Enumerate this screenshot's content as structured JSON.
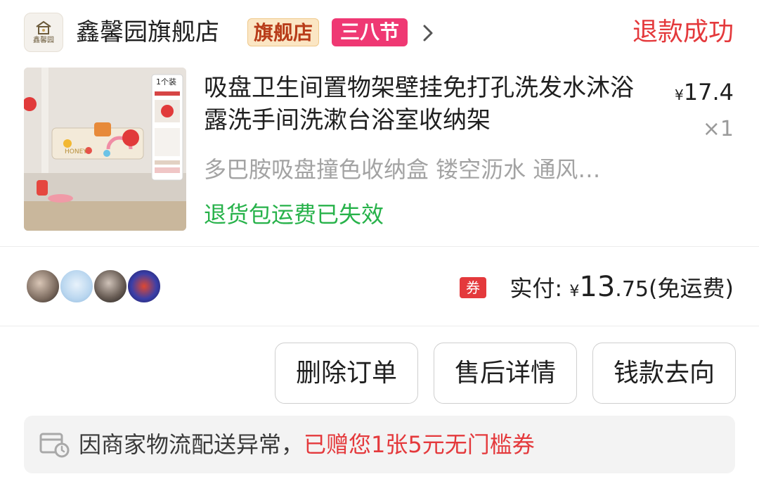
{
  "store": {
    "logo_text": "鑫馨园",
    "name": "鑫馨园旗舰店",
    "badge_flagship": "旗舰店",
    "badge_event": "三八节",
    "chevron_icon": "chevron-right-icon"
  },
  "order": {
    "status": "退款成功",
    "status_color": "#e4393c"
  },
  "product": {
    "title": "吸盘卫生间置物架壁挂免打孔洗发水沐浴露洗手间洗漱台浴室收纳架",
    "price_symbol": "¥",
    "price": "17.4",
    "quantity": "×1",
    "spec": "多巴胺吸盘撞色收纳盒 镂空沥水 通风…",
    "return_note": "退货包运费已失效",
    "image_labels": {
      "count": "1个装",
      "tag": "HONEY"
    }
  },
  "payment": {
    "coupon_icon_text": "券",
    "label": "实付:",
    "symbol": "¥",
    "amount_int": "13",
    "amount_dec": ".75",
    "shipping": "(免运费)"
  },
  "actions": {
    "delete": "删除订单",
    "after_sale": "售后详情",
    "money_flow": "钱款去向"
  },
  "notice": {
    "icon": "delivery-truck-clock-icon",
    "text": "因商家物流配送异常，",
    "highlight": "已赠您1张5元无门槛券"
  },
  "colors": {
    "accent_red": "#e4393c",
    "green": "#27b24a",
    "event_pink": "#ef3873"
  }
}
